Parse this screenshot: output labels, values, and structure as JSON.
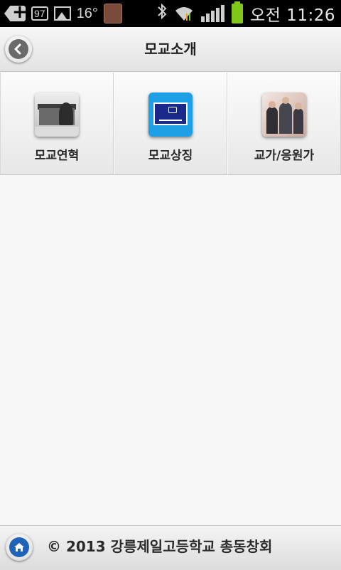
{
  "status_bar": {
    "badge": "97",
    "temperature": "16°",
    "time": "오전 11:26",
    "icons": [
      "plus-icon",
      "battery-badge-icon",
      "picture-icon",
      "app-icon",
      "bluetooth-icon",
      "wifi-icon",
      "signal-icon",
      "battery-icon"
    ],
    "battery_color": "#7ec71b"
  },
  "header": {
    "title": "모교소개",
    "back_icon": "chevron-left-icon"
  },
  "menu": {
    "items": [
      {
        "label": "모교연혁",
        "thumbnail": "school-building-photo"
      },
      {
        "label": "모교상징",
        "thumbnail": "school-flag-image"
      },
      {
        "label": "교가/응원가",
        "thumbnail": "students-singing-photo"
      }
    ]
  },
  "footer": {
    "home_icon": "home-icon",
    "copyright": "© 2013 강릉제일고등학교 총동창회"
  },
  "colors": {
    "home_button": "#1f63b8",
    "flag_background": "#1e9fe6"
  }
}
